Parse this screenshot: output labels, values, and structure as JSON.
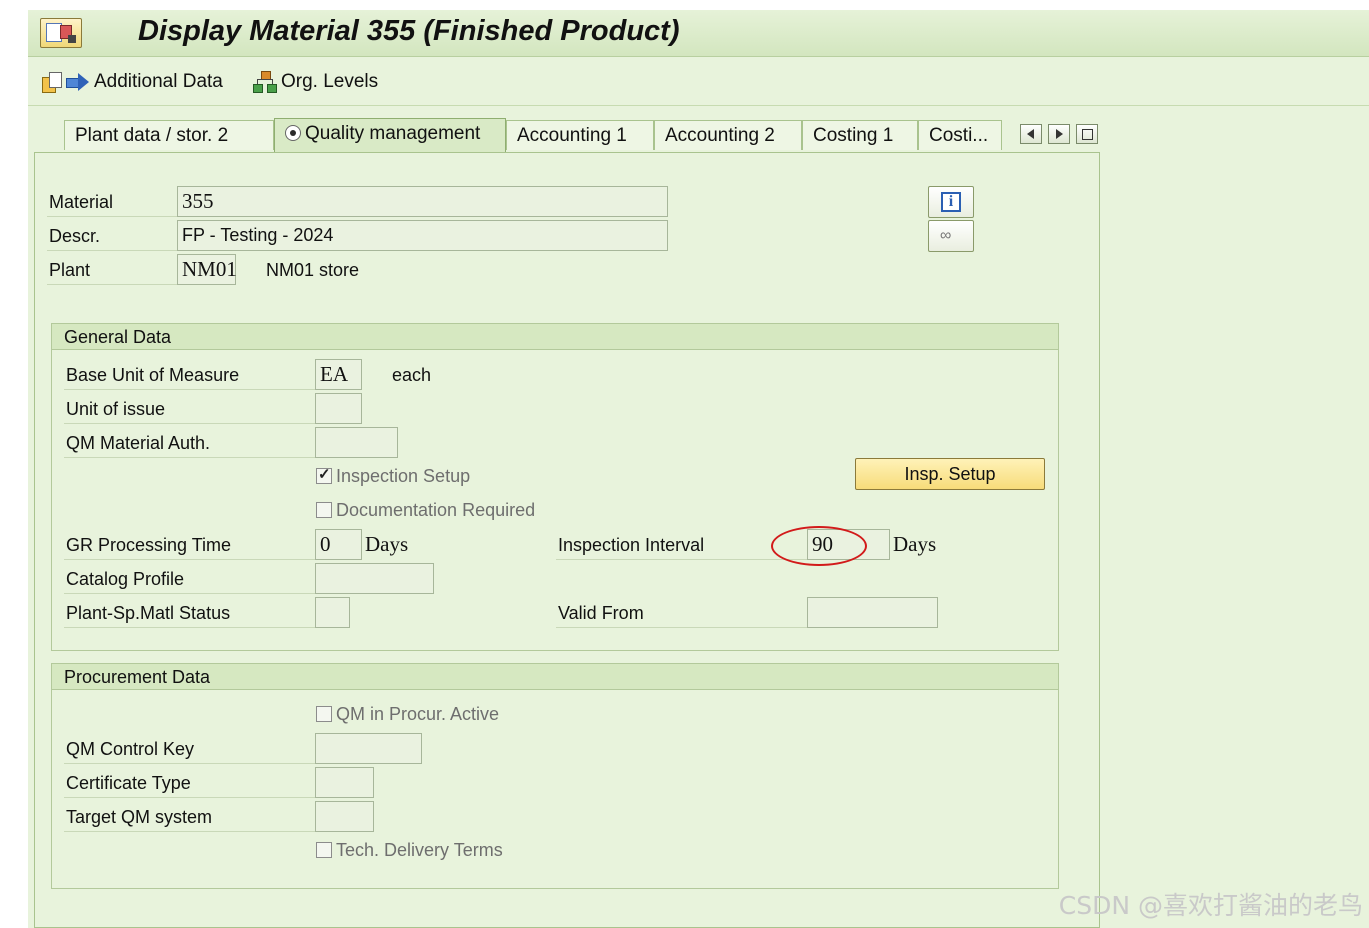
{
  "window": {
    "title": "Display Material 355 (Finished Product)"
  },
  "toolbar": {
    "additional_data": "Additional Data",
    "org_levels": "Org. Levels"
  },
  "tabs": [
    {
      "label": "Plant data / stor. 2",
      "active": false
    },
    {
      "label": "Quality management",
      "active": true
    },
    {
      "label": "Accounting 1",
      "active": false
    },
    {
      "label": "Accounting 2",
      "active": false
    },
    {
      "label": "Costing 1",
      "active": false
    },
    {
      "label": "Costi...",
      "active": false
    }
  ],
  "header": {
    "material_label": "Material",
    "material_value": "355",
    "descr_label": "Descr.",
    "descr_value": "FP - Testing - 2024",
    "plant_label": "Plant",
    "plant_value": "NM01",
    "plant_desc": "NM01 store"
  },
  "general": {
    "title": "General Data",
    "base_uom_label": "Base Unit of Measure",
    "base_uom_value": "EA",
    "base_uom_text": "each",
    "unit_issue_label": "Unit of issue",
    "unit_issue_value": "",
    "qm_auth_label": "QM Material Auth.",
    "qm_auth_value": "",
    "inspection_setup_label": "Inspection Setup",
    "inspection_setup_checked": true,
    "insp_setup_button": "Insp. Setup",
    "doc_required_label": "Documentation Required",
    "doc_required_checked": false,
    "gr_time_label": "GR Processing Time",
    "gr_time_value": "0",
    "gr_time_unit": "Days",
    "insp_interval_label": "Inspection Interval",
    "insp_interval_value": "90",
    "insp_interval_unit": "Days",
    "catalog_profile_label": "Catalog Profile",
    "catalog_profile_value": "",
    "plant_status_label": "Plant-Sp.Matl Status",
    "plant_status_value": "",
    "valid_from_label": "Valid From",
    "valid_from_value": ""
  },
  "procurement": {
    "title": "Procurement Data",
    "qm_procur_label": "QM in Procur. Active",
    "qm_procur_checked": false,
    "qm_control_key_label": "QM Control Key",
    "qm_control_key_value": "",
    "certificate_type_label": "Certificate Type",
    "certificate_type_value": "",
    "target_qm_label": "Target QM system",
    "target_qm_value": "",
    "tech_delivery_label": "Tech. Delivery Terms",
    "tech_delivery_checked": false
  },
  "watermark": "CSDN @喜欢打酱油的老鸟"
}
